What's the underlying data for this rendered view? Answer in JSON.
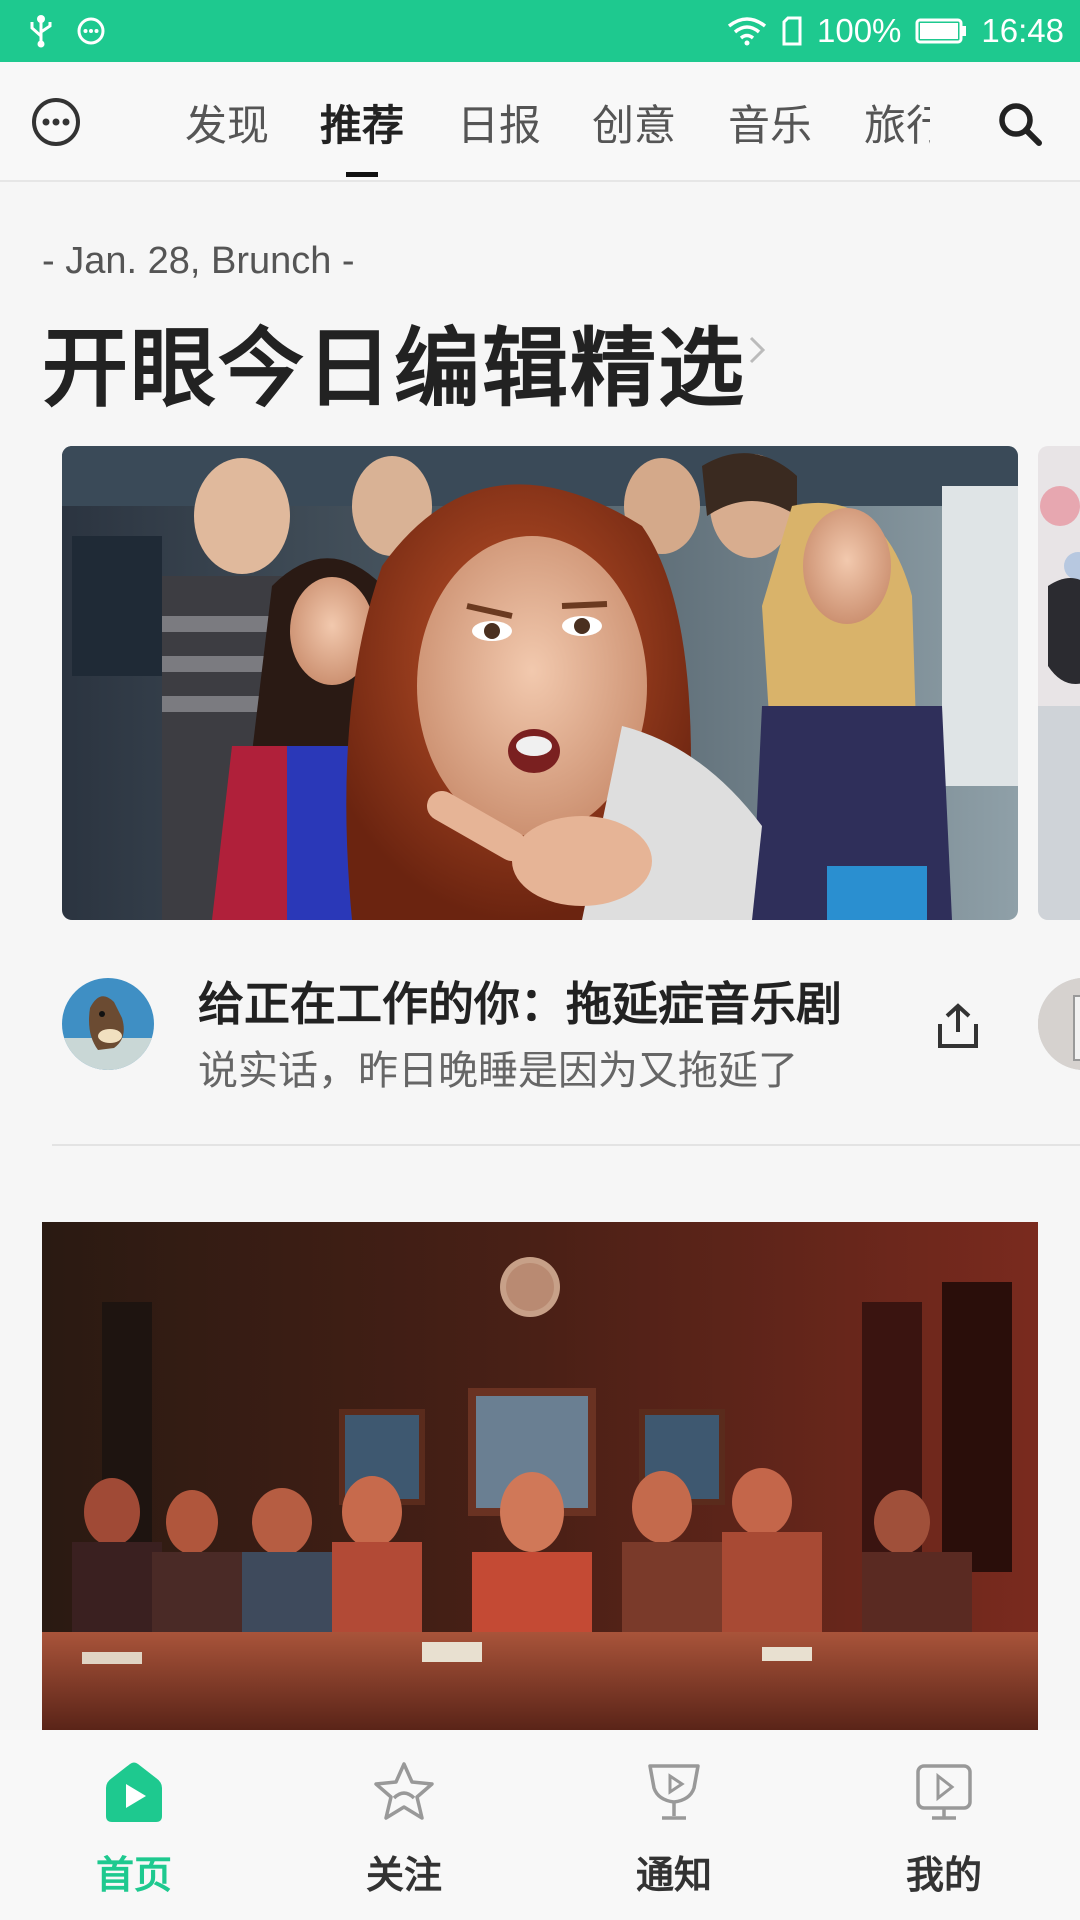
{
  "status_bar": {
    "battery_percent": "100%",
    "time": "16:48",
    "icons": [
      "usb-icon",
      "message-icon",
      "wifi-icon",
      "sim-icon",
      "battery-icon"
    ]
  },
  "top_nav": {
    "menu_icon": "more-icon",
    "search_icon": "search-icon",
    "tabs": [
      {
        "label": "发现",
        "active": false
      },
      {
        "label": "推荐",
        "active": true
      },
      {
        "label": "日报",
        "active": false
      },
      {
        "label": "创意",
        "active": false
      },
      {
        "label": "音乐",
        "active": false
      },
      {
        "label": "旅行",
        "active": false
      }
    ]
  },
  "section": {
    "date": "- Jan. 28, Brunch -",
    "title": "开眼今日编辑精选"
  },
  "featured_card": {
    "title": "给正在工作的你：拖延症音乐剧",
    "subtitle": "说实话，昨日晚睡是因为又拖延了",
    "share_icon": "share-icon"
  },
  "bottom_nav": {
    "items": [
      {
        "label": "首页",
        "icon": "home-icon",
        "active": true
      },
      {
        "label": "关注",
        "icon": "star-icon",
        "active": false
      },
      {
        "label": "通知",
        "icon": "trophy-icon",
        "active": false
      },
      {
        "label": "我的",
        "icon": "profile-icon",
        "active": false
      }
    ]
  },
  "colors": {
    "accent": "#1ec98f",
    "text_primary": "#222222",
    "text_secondary": "#666666"
  }
}
